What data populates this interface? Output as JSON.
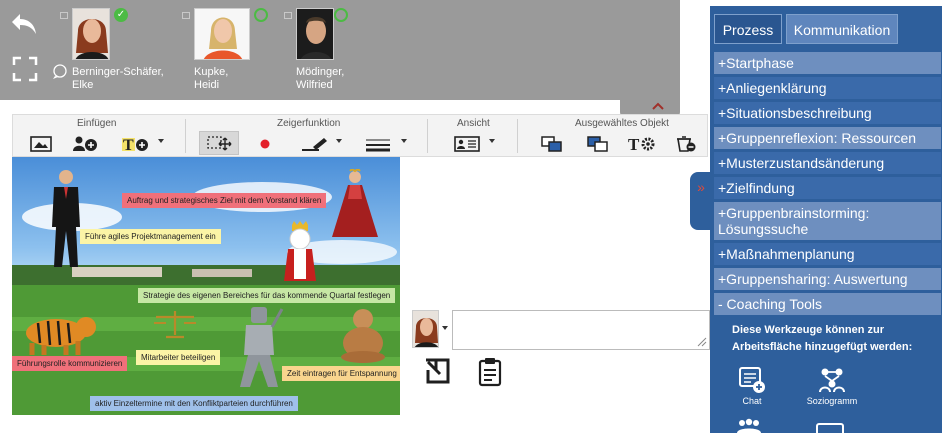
{
  "participants": [
    {
      "name": "Berninger-Schäfer, Elke",
      "status": "online",
      "status_glyph": "✓"
    },
    {
      "name": "Kupke, Heidi",
      "status": "offline"
    },
    {
      "name": "Mödinger, Wilfried",
      "status": "offline"
    }
  ],
  "toolbar": {
    "groups": {
      "einfuegen": "Einfügen",
      "zeigerfunktion": "Zeigerfunktion",
      "ansicht": "Ansicht",
      "ausgewaehlt": "Ausgewähltes Objekt"
    }
  },
  "canvas": {
    "notes": [
      "Auftrag und strategisches Ziel mit dem Vorstand klären",
      "Führe agiles Projektmanagement ein",
      "Strategie des eigenen Bereiches für das kommende Quartal festlegen",
      "Führungsrolle kommunizieren",
      "Mitarbeiter beteiligen",
      "Zeit eintragen für Entspannung",
      "aktiv Einzeltermine mit den Konfliktparteien durchführen"
    ]
  },
  "panel": {
    "tabs": [
      "Prozess",
      "Kommunikation"
    ],
    "steps": [
      "+Startphase",
      "+Anliegenklärung",
      "+Situationsbeschreibung",
      "+Gruppenreflexion: Ressourcen",
      "+Musterzustandsänderung",
      "+Zielfindung",
      "+Gruppenbrainstorming: Lösungssuche",
      "+Maßnahmenplanung",
      "+Gruppensharing: Auswertung",
      "- Coaching Tools"
    ],
    "tools_info": "Diese Werkzeuge können zur Arbeitsfläche hinzugefügt werden:",
    "tools": [
      "Chat",
      "Soziogramm"
    ]
  },
  "colors": {
    "panel_bg": "#2e5f9c",
    "step_dark": "#3a6aaa",
    "step_light": "#6e8fbf",
    "note_red": "#f0707a",
    "note_yellow": "#fbf4a6",
    "note_green": "#c6e7a4",
    "note_orange": "#f9d58e",
    "note_blue": "#9fc0ea",
    "status_green": "#4cbb44"
  },
  "icons": [
    "back-arrow-icon",
    "fullscreen-icon",
    "chat-bubble-icon",
    "collapse-up-icon",
    "expand-panel-icon",
    "insert-image-icon",
    "add-person-icon",
    "add-text-icon",
    "select-move-icon",
    "laser-pointer-icon",
    "pen-icon",
    "line-style-icon",
    "view-card-icon",
    "bring-front-icon",
    "send-back-icon",
    "text-settings-icon",
    "delete-icon",
    "undo-icon",
    "clipboard-icon",
    "chat-tool-icon",
    "sociogram-tool-icon"
  ]
}
